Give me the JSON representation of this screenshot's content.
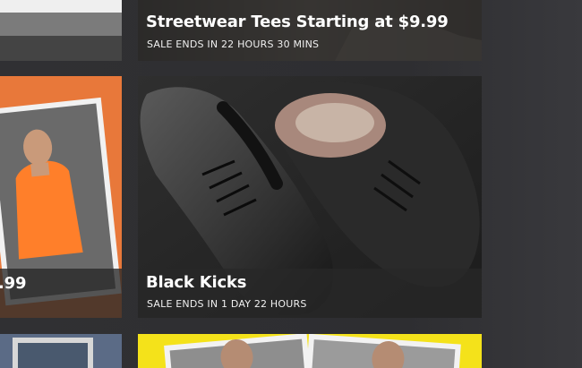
{
  "deals": [
    {
      "title": "Streetwear Tees Starting at $9.99",
      "ends": "SALE ENDS IN 22 HOURS 30 MINS"
    },
    {
      "title": "Black Kicks",
      "ends": "SALE ENDS IN 1 DAY 22 HOURS"
    }
  ],
  "left_tile": {
    "price_fragment": ".99"
  },
  "colors": {
    "background": "#2e2e31",
    "caption_overlay": "#282828",
    "orange_tile": "#e8783a",
    "yellow_tile": "#f4e21a"
  }
}
